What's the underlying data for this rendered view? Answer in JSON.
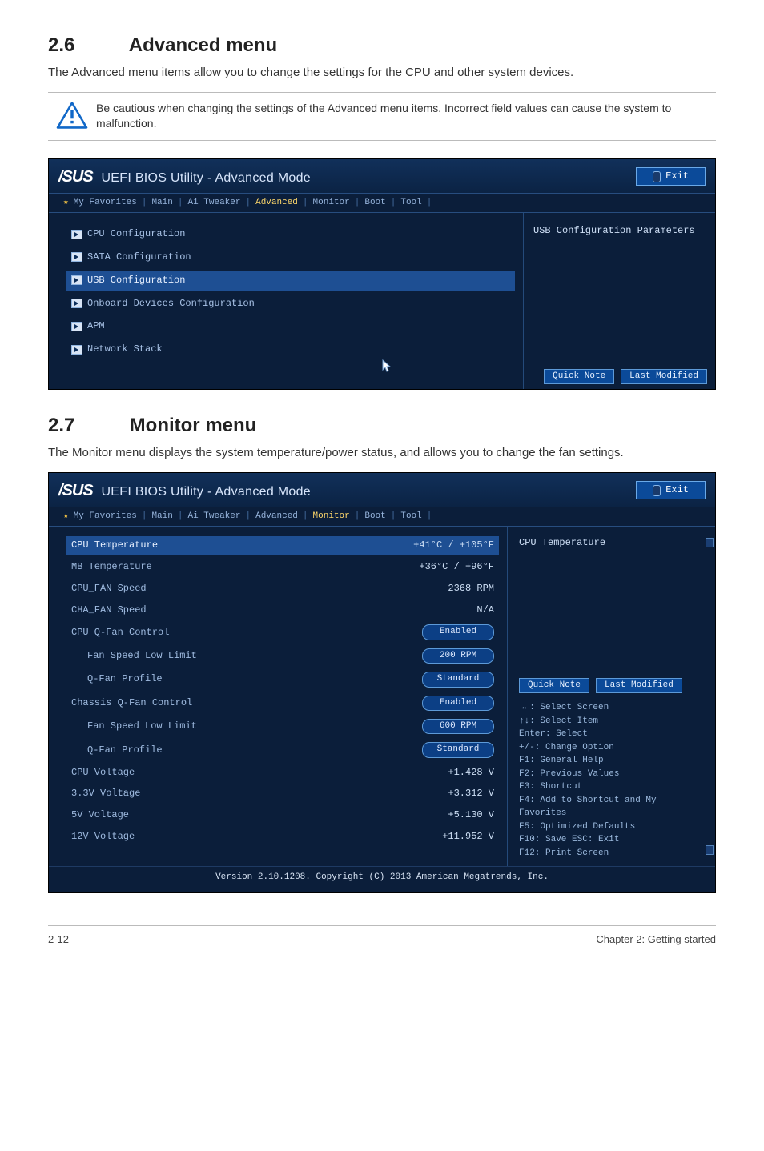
{
  "sections": {
    "s26": {
      "num": "2.6",
      "title": "Advanced menu",
      "body": "The Advanced menu items allow you to change the settings for the CPU and other system devices.",
      "note": "Be cautious when changing the settings of the Advanced menu items. Incorrect field values can cause the system to malfunction."
    },
    "s27": {
      "num": "2.7",
      "title": "Monitor menu",
      "body": "The Monitor menu displays the system temperature/power status, and allows you to change the fan settings."
    }
  },
  "bios_common": {
    "brand": "/SUS",
    "title": "UEFI BIOS Utility - Advanced Mode",
    "exit": "Exit",
    "tabs": [
      "My Favorites",
      "Main",
      "Ai Tweaker",
      "Advanced",
      "Monitor",
      "Boot",
      "Tool"
    ],
    "quick_note": "Quick Note",
    "last_modified": "Last Modified",
    "copyright": "Version 2.10.1208. Copyright (C) 2013 American Megatrends, Inc."
  },
  "bios_advanced": {
    "items": [
      "CPU Configuration",
      "SATA Configuration",
      "USB Configuration",
      "Onboard Devices Configuration",
      "APM",
      "Network Stack"
    ],
    "selected_index": 2,
    "right_title": "USB Configuration Parameters"
  },
  "bios_monitor": {
    "rows": [
      {
        "label": "CPU Temperature",
        "value": "+41°C / +105°F",
        "type": "text",
        "selected": true
      },
      {
        "label": "MB Temperature",
        "value": "+36°C / +96°F",
        "type": "text"
      },
      {
        "label": "CPU_FAN Speed",
        "value": "2368 RPM",
        "type": "text"
      },
      {
        "label": "CHA_FAN Speed",
        "value": "N/A",
        "type": "text"
      },
      {
        "label": "CPU Q-Fan Control",
        "value": "Enabled",
        "type": "pill"
      },
      {
        "label": "Fan Speed Low Limit",
        "value": "200 RPM",
        "type": "pill",
        "indent": true
      },
      {
        "label": "Q-Fan Profile",
        "value": "Standard",
        "type": "pill",
        "indent": true
      },
      {
        "label": "Chassis Q-Fan Control",
        "value": "Enabled",
        "type": "pill"
      },
      {
        "label": "Fan Speed Low Limit",
        "value": "600 RPM",
        "type": "pill",
        "indent": true
      },
      {
        "label": "Q-Fan Profile",
        "value": "Standard",
        "type": "pill",
        "indent": true
      },
      {
        "label": "CPU Voltage",
        "value": "+1.428 V",
        "type": "text"
      },
      {
        "label": "3.3V Voltage",
        "value": "+3.312 V",
        "type": "text"
      },
      {
        "label": "5V Voltage",
        "value": "+5.130 V",
        "type": "text"
      },
      {
        "label": "12V Voltage",
        "value": "+11.952 V",
        "type": "text"
      }
    ],
    "right_title": "CPU Temperature",
    "hints": [
      "→←: Select Screen",
      "↑↓: Select Item",
      "Enter: Select",
      "+/-: Change Option",
      "F1: General Help",
      "F2: Previous Values",
      "F3: Shortcut",
      "F4: Add to Shortcut and My Favorites",
      "F5: Optimized Defaults",
      "F10: Save  ESC: Exit",
      "F12: Print Screen"
    ]
  },
  "footer": {
    "page": "2-12",
    "chapter": "Chapter 2: Getting started"
  }
}
